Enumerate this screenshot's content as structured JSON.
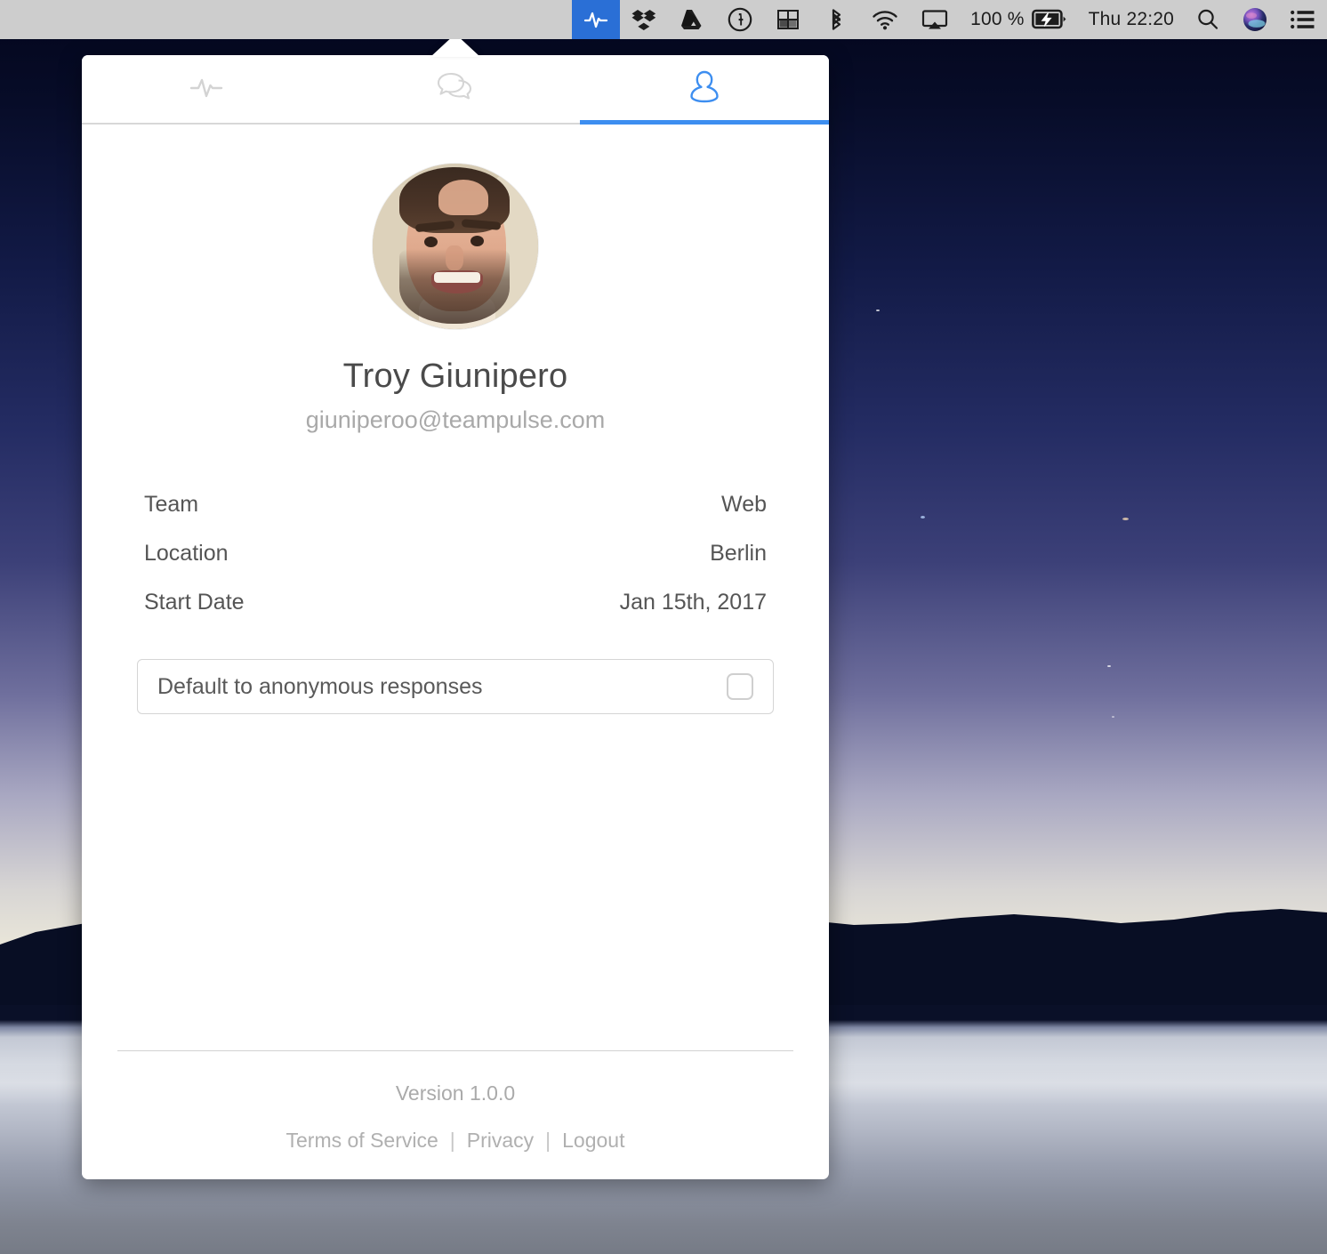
{
  "menubar": {
    "left_icons": [
      {
        "name": "teampulse-icon",
        "label": "TeamPulse",
        "active": true
      },
      {
        "name": "dropbox-icon",
        "label": "Dropbox",
        "active": false
      },
      {
        "name": "google-drive-icon",
        "label": "Google Drive",
        "active": false
      },
      {
        "name": "onepassword-icon",
        "label": "1Password",
        "active": false
      },
      {
        "name": "window-grid-icon",
        "label": "Window Manager",
        "active": false
      },
      {
        "name": "bluetooth-icon",
        "label": "Bluetooth",
        "active": false
      },
      {
        "name": "wifi-icon",
        "label": "Wi-Fi",
        "active": false
      },
      {
        "name": "airplay-icon",
        "label": "AirPlay",
        "active": false
      }
    ],
    "battery_percent": "100 %",
    "battery_icon": "battery-charging-icon",
    "clock": "Thu 22:20",
    "search_icon": "search-icon",
    "siri_icon": "siri-icon",
    "notification_center_icon": "notification-center-icon"
  },
  "popover": {
    "tabs": [
      {
        "icon": "pulse-icon",
        "label": "Pulse",
        "selected": false
      },
      {
        "icon": "chat-bubbles-icon",
        "label": "Messages",
        "selected": false
      },
      {
        "icon": "person-icon",
        "label": "Profile",
        "selected": true
      }
    ],
    "accent_color": "#3d8ef0",
    "profile": {
      "avatar_alt": "Troy Giunipero profile photo",
      "name": "Troy Giunipero",
      "email": "giuniperoo@teampulse.com",
      "fields": [
        {
          "label": "Team",
          "value": "Web"
        },
        {
          "label": "Location",
          "value": "Berlin"
        },
        {
          "label": "Start Date",
          "value": "Jan 15th, 2017"
        }
      ],
      "anonymous_setting": {
        "label": "Default to anonymous responses",
        "checked": false
      }
    },
    "footer": {
      "version": "Version 1.0.0",
      "links": [
        {
          "label": "Terms of Service"
        },
        {
          "label": "Privacy"
        },
        {
          "label": "Logout"
        }
      ],
      "separator": "|"
    }
  }
}
